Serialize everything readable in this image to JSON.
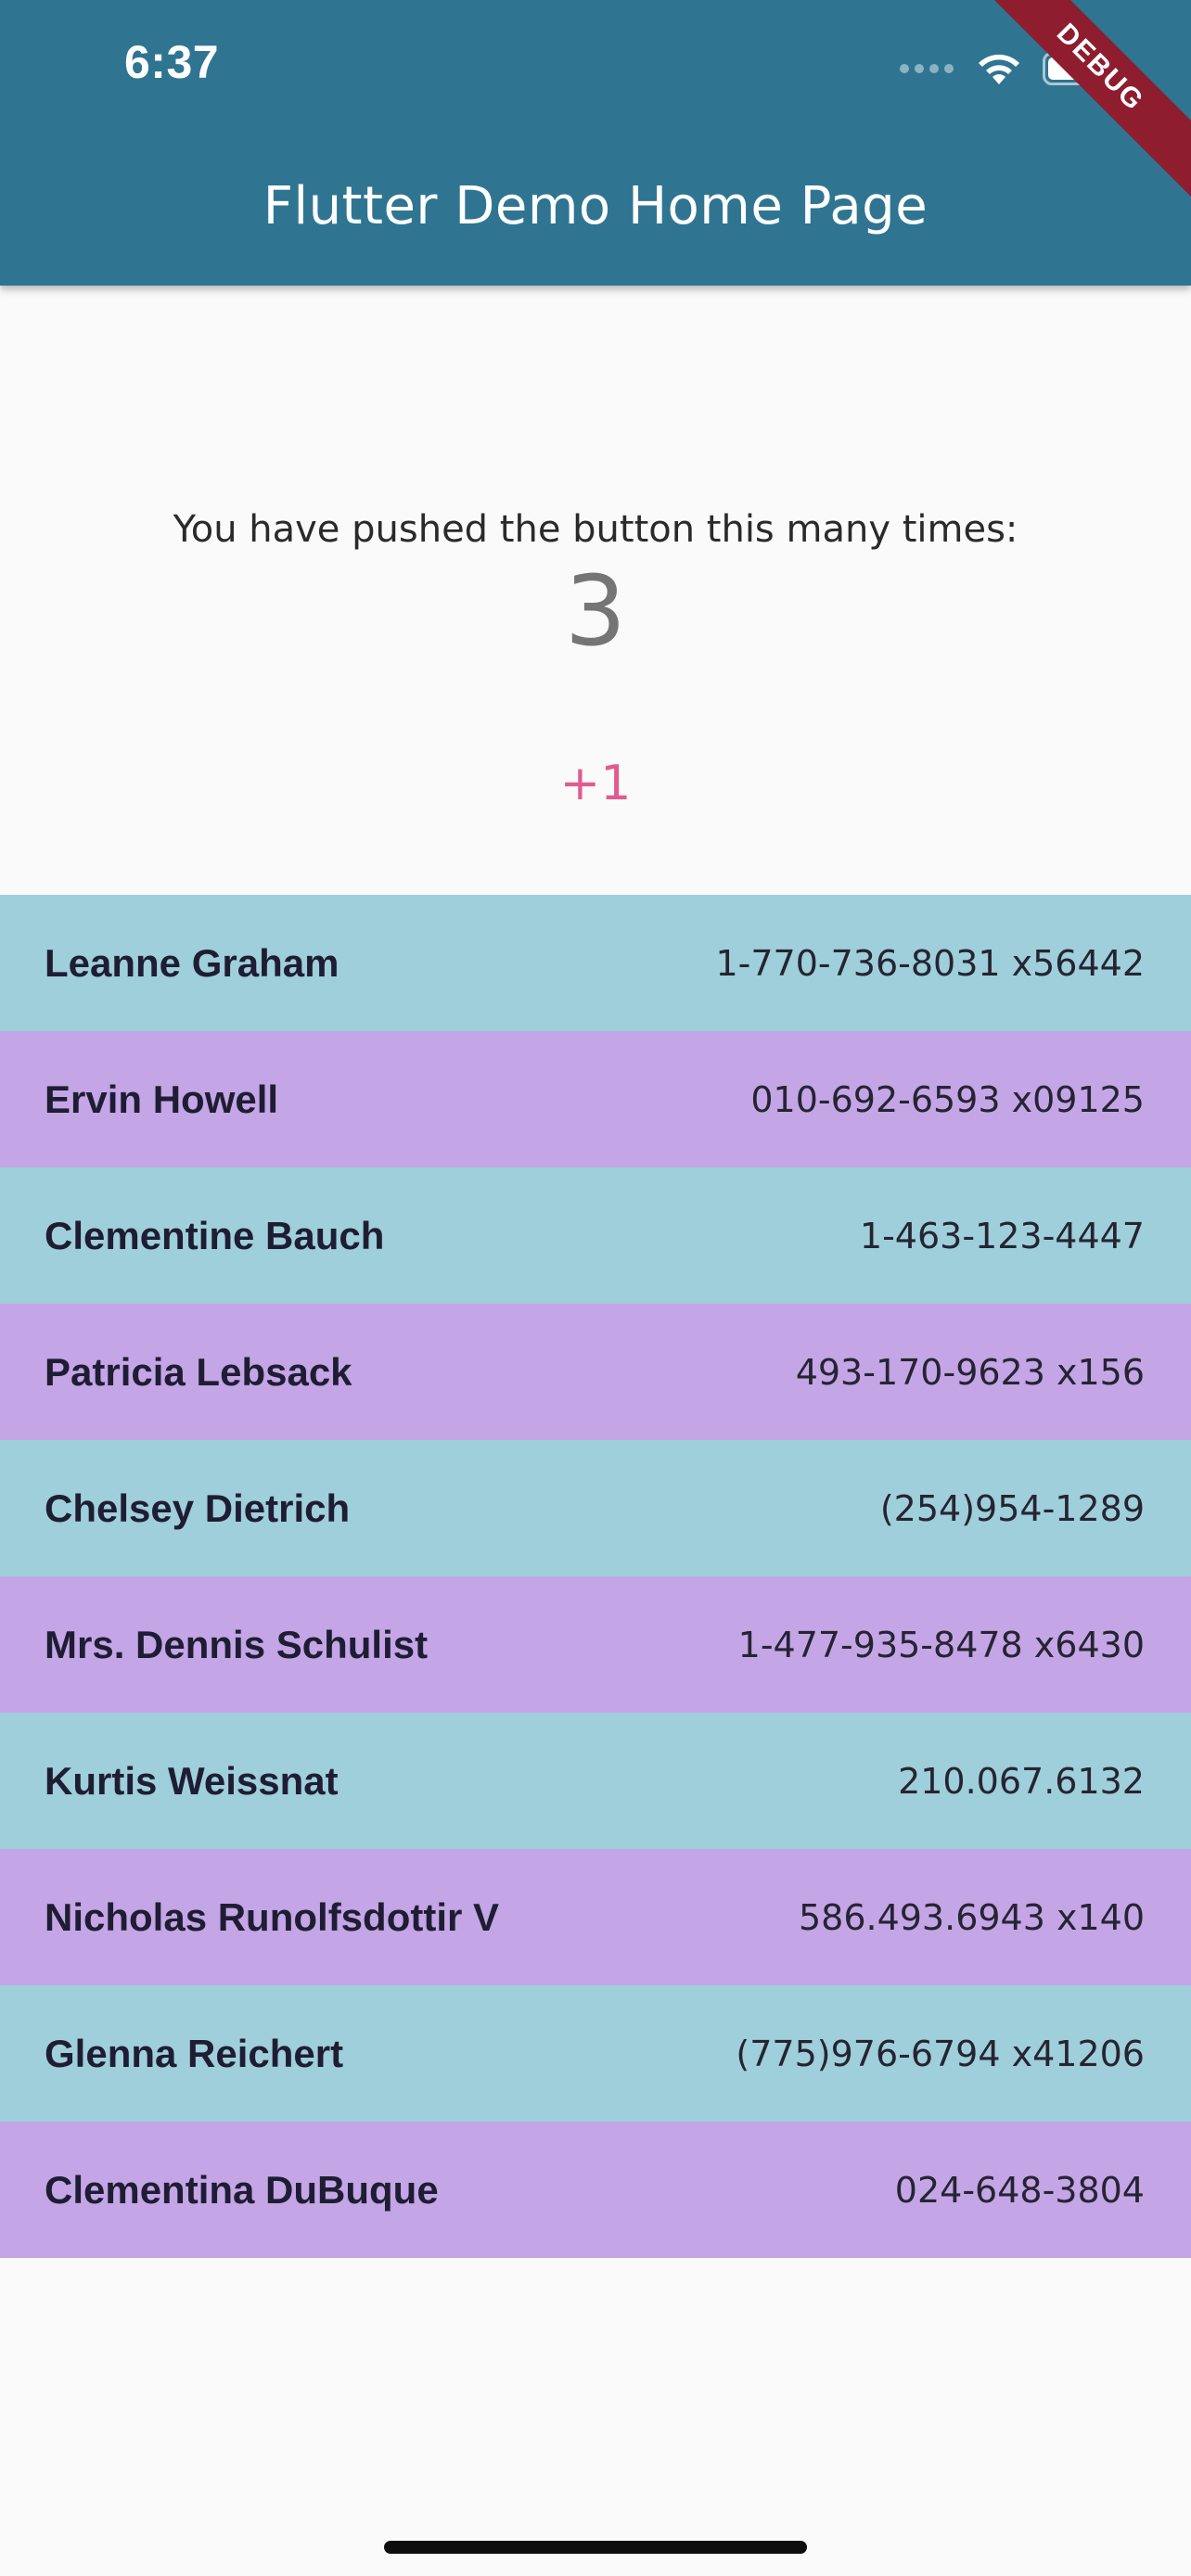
{
  "status_bar": {
    "time": "6:37",
    "icons": [
      "signal-dots-icon",
      "wifi-icon",
      "battery-icon"
    ]
  },
  "app_bar": {
    "title": "Flutter Demo Home Page",
    "color": "#2f7592"
  },
  "debug_banner": "DEBUG",
  "counter": {
    "label": "You have pushed the button this many times:",
    "value": "3"
  },
  "increment_button": {
    "label": "+1",
    "color": "#e15b8f"
  },
  "row_colors": {
    "odd": "#9ecfda",
    "even": "#c4a5e6"
  },
  "contacts": [
    {
      "name": "Leanne Graham",
      "phone": "1-770-736-8031 x56442"
    },
    {
      "name": "Ervin Howell",
      "phone": "010-692-6593 x09125"
    },
    {
      "name": "Clementine Bauch",
      "phone": "1-463-123-4447"
    },
    {
      "name": "Patricia Lebsack",
      "phone": "493-170-9623 x156"
    },
    {
      "name": "Chelsey Dietrich",
      "phone": "(254)954-1289"
    },
    {
      "name": "Mrs. Dennis Schulist",
      "phone": "1-477-935-8478 x6430"
    },
    {
      "name": "Kurtis Weissnat",
      "phone": "210.067.6132"
    },
    {
      "name": "Nicholas Runolfsdottir V",
      "phone": "586.493.6943 x140"
    },
    {
      "name": "Glenna Reichert",
      "phone": "(775)976-6794 x41206"
    },
    {
      "name": "Clementina DuBuque",
      "phone": "024-648-3804"
    }
  ]
}
